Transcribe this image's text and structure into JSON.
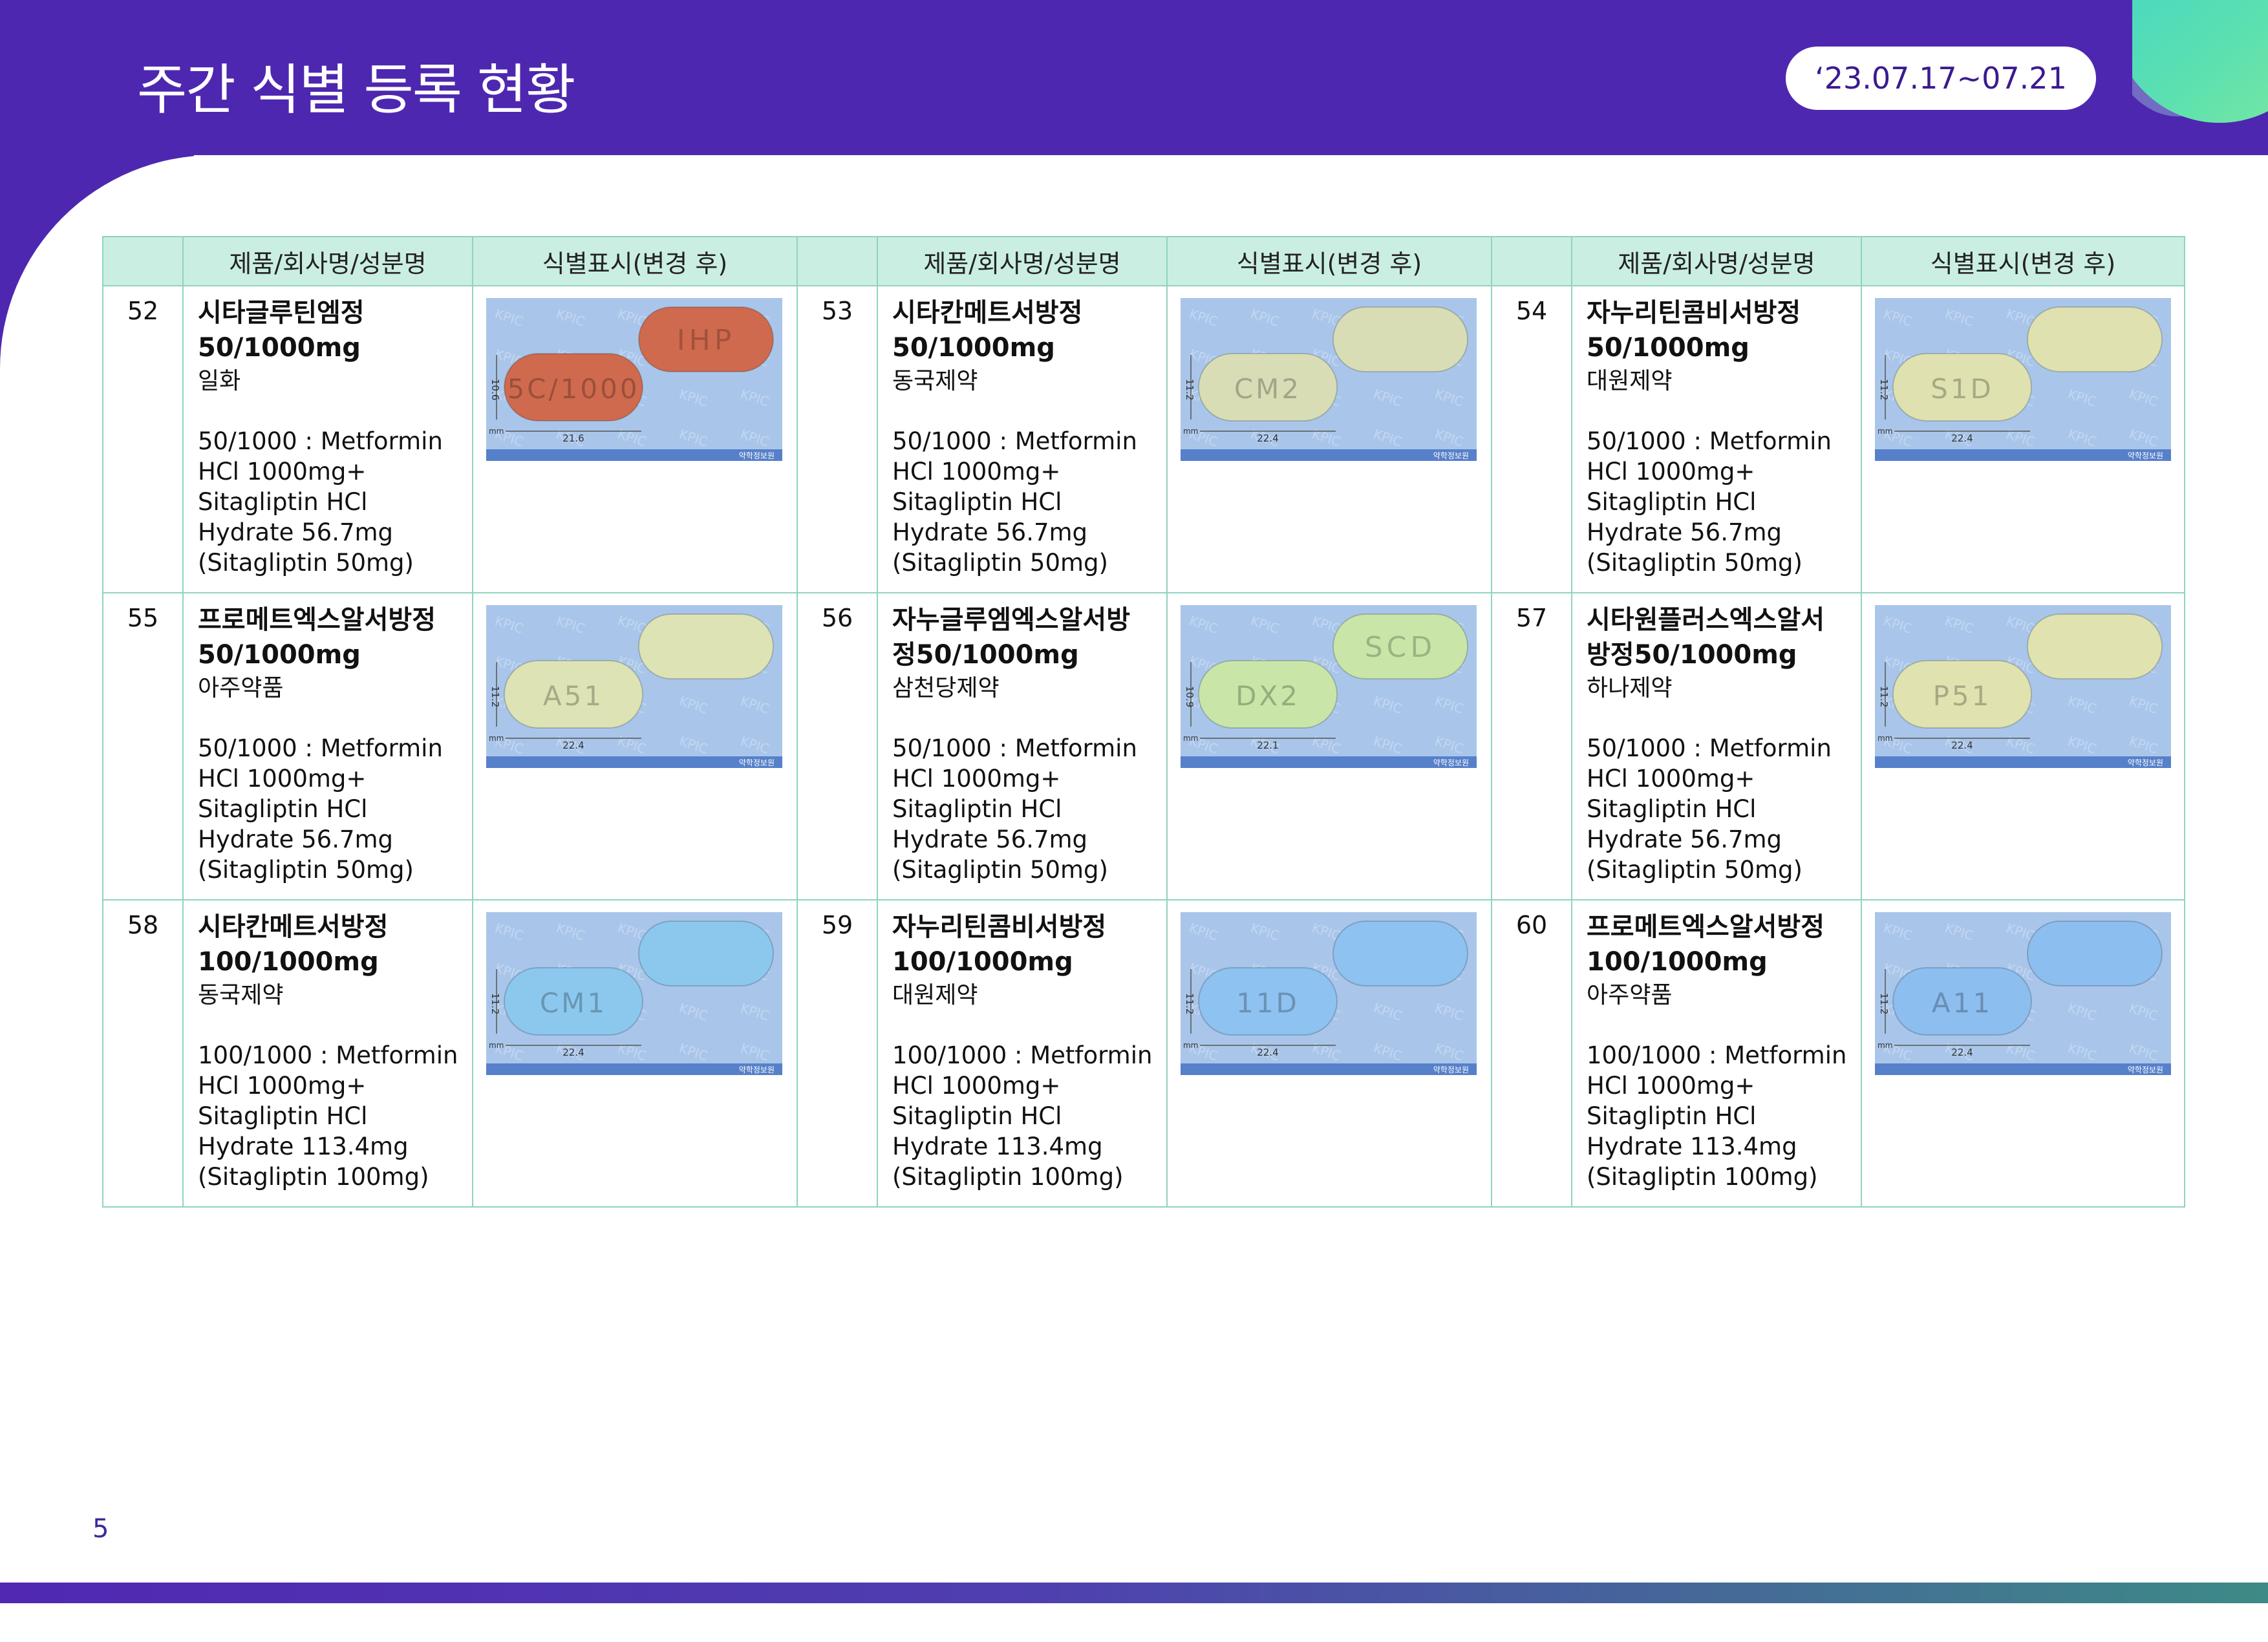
{
  "header": {
    "title": "주간 식별 등록 현황",
    "date_range": "‘23.07.17~07.21"
  },
  "table": {
    "headers": [
      "제품/회사명/성분명",
      "식별표시(변경 후)"
    ],
    "rows": [
      [
        {
          "no": "52",
          "name": "시타글루틴엠정\n50/1000mg",
          "company": "일화",
          "ingredient": "50/1000 : Metformin HCl 1000mg+ Sitagliptin HCl Hydrate 56.7mg (Sitagliptin 50mg)",
          "pill": {
            "color": "#cf6a4e",
            "text_back": "IHP",
            "text_front": "5C/1000",
            "dim_w": "21.6",
            "dim_h": "10.6"
          }
        },
        {
          "no": "53",
          "name": "시타칸메트서방정\n50/1000mg",
          "company": "동국제약",
          "ingredient": "50/1000 : Metformin HCl 1000mg+ Sitagliptin HCl Hydrate 56.7mg (Sitagliptin 50mg)",
          "pill": {
            "color": "#d9ddb6",
            "text_back": "",
            "text_front": "CM2",
            "dim_w": "22.4",
            "dim_h": "11.2"
          }
        },
        {
          "no": "54",
          "name": "자누리틴콤비서방정\n50/1000mg",
          "company": "대원제약",
          "ingredient": "50/1000 : Metformin HCl 1000mg+ Sitagliptin HCl Hydrate 56.7mg (Sitagliptin 50mg)",
          "pill": {
            "color": "#dfe2b0",
            "text_back": "",
            "text_front": "S1D",
            "dim_w": "22.4",
            "dim_h": "11.2"
          }
        }
      ],
      [
        {
          "no": "55",
          "name": "프로메트엑스알서방정\n50/1000mg",
          "company": "아주약품",
          "ingredient": "50/1000 : Metformin HCl 1000mg+ Sitagliptin HCl Hydrate 56.7mg (Sitagliptin 50mg)",
          "pill": {
            "color": "#dde3b4",
            "text_back": "",
            "text_front": "A51",
            "dim_w": "22.4",
            "dim_h": "11.2"
          }
        },
        {
          "no": "56",
          "name": "자누글루엠엑스알서방\n정50/1000mg",
          "company": "삼천당제약",
          "ingredient": "50/1000 : Metformin HCl 1000mg+ Sitagliptin HCl Hydrate 56.7mg (Sitagliptin 50mg)",
          "pill": {
            "color": "#c9e6a8",
            "text_back": "SCD",
            "text_front": "DX2",
            "dim_w": "22.1",
            "dim_h": "10.9"
          }
        },
        {
          "no": "57",
          "name": "시타원플러스엑스알서\n방정50/1000mg",
          "company": "하나제약",
          "ingredient": "50/1000 : Metformin HCl 1000mg+ Sitagliptin HCl Hydrate 56.7mg (Sitagliptin 50mg)",
          "pill": {
            "color": "#e0e2b0",
            "text_back": "",
            "text_front": "P51",
            "dim_w": "22.4",
            "dim_h": "11.2"
          }
        }
      ],
      [
        {
          "no": "58",
          "name": "시타칸메트서방정\n100/1000mg",
          "company": "동국제약",
          "ingredient": "100/1000 : Metformin HCl 1000mg+ Sitagliptin HCl Hydrate 113.4mg (Sitagliptin 100mg)",
          "pill": {
            "color": "#8cc8ee",
            "text_back": "",
            "text_front": "CM1",
            "dim_w": "22.4",
            "dim_h": "11.2"
          }
        },
        {
          "no": "59",
          "name": "자누리틴콤비서방정\n100/1000mg",
          "company": "대원제약",
          "ingredient": "100/1000 : Metformin HCl 1000mg+ Sitagliptin HCl Hydrate 113.4mg (Sitagliptin 100mg)",
          "pill": {
            "color": "#8ec2f0",
            "text_back": "",
            "text_front": "11D",
            "dim_w": "22.4",
            "dim_h": "11.2"
          }
        },
        {
          "no": "60",
          "name": "프로메트엑스알서방정\n100/1000mg",
          "company": "아주약품",
          "ingredient": "100/1000 : Metformin HCl 1000mg+ Sitagliptin HCl Hydrate 113.4mg (Sitagliptin 100mg)",
          "pill": {
            "color": "#8cbeef",
            "text_back": "",
            "text_front": "A11",
            "dim_w": "22.4",
            "dim_h": "11.2"
          }
        }
      ]
    ]
  },
  "pill_image": {
    "watermark": "KPIC",
    "unit": "mm",
    "footer_logo": "약학정보원",
    "background": "#a9c6ea",
    "band": "#5680c9"
  },
  "footer": {
    "page_number": "5"
  }
}
